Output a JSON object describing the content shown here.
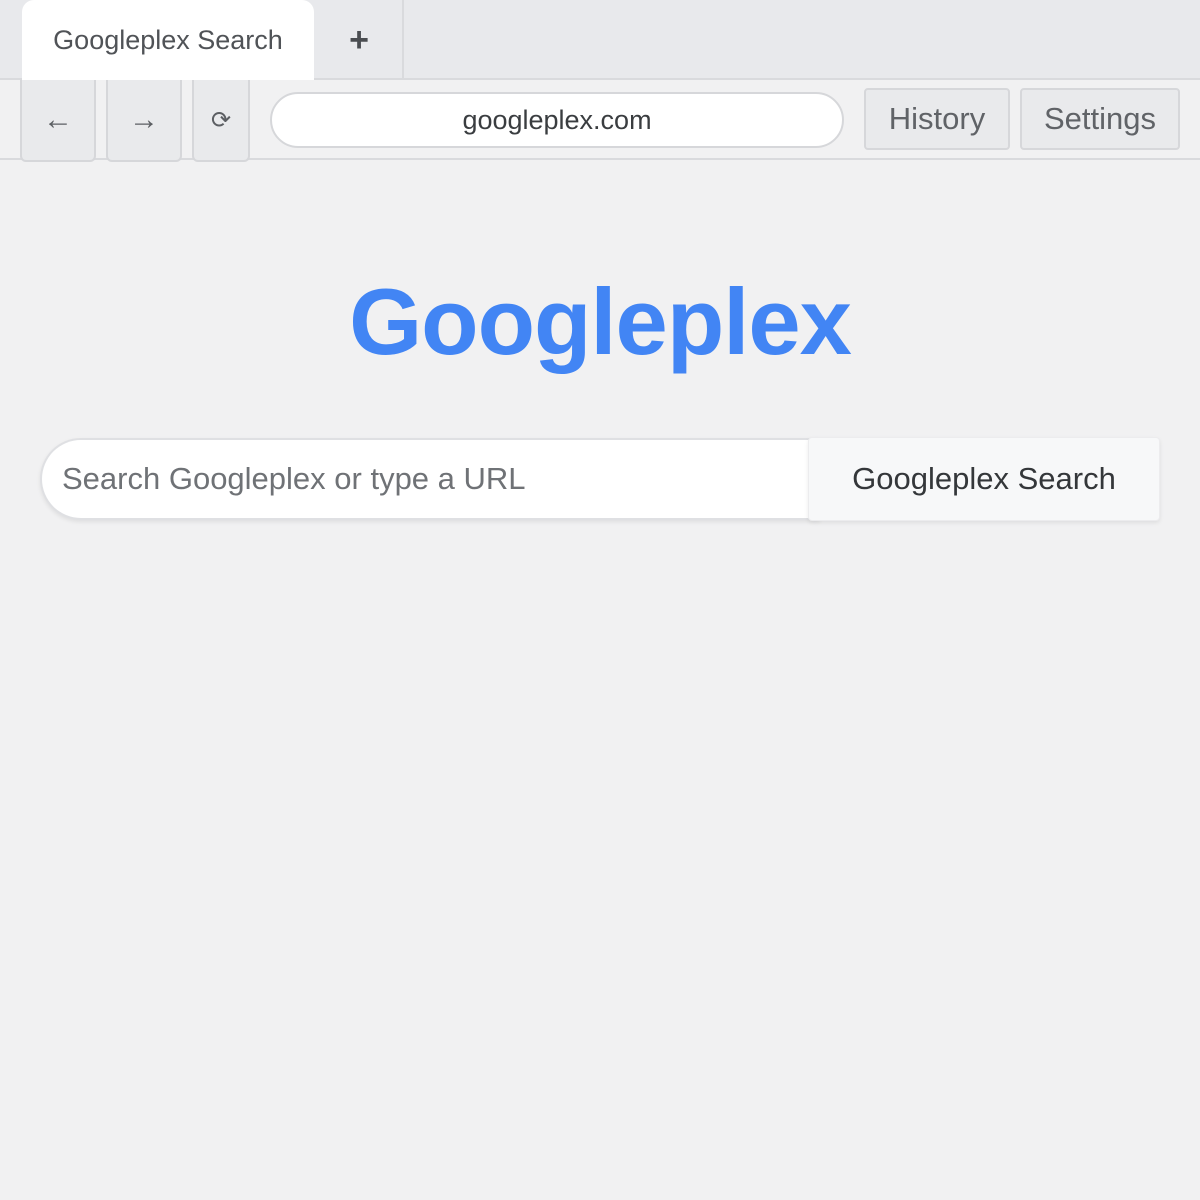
{
  "tabs": [
    {
      "label": "Googleplex Search",
      "active": true
    }
  ],
  "tabbar": {
    "new_tab_label": "+"
  },
  "toolbar": {
    "back_label": "←",
    "forward_label": "→",
    "reload_label": "⟳",
    "address": "googleplex.com",
    "history_label": "History",
    "settings_label": "Settings"
  },
  "page": {
    "logo_text": "Googleplex",
    "logo_color": "#4285f4",
    "search_placeholder": "Search Googleplex or type a URL",
    "search_value": "",
    "search_button_label": "Googleplex Search"
  }
}
